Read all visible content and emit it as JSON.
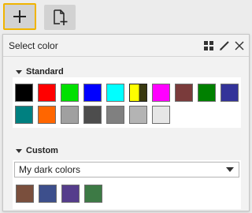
{
  "toolbar": {
    "add_icon": "plus-icon",
    "new_icon": "page-add-icon",
    "accent": "#f0b400"
  },
  "panel": {
    "title": "Select color",
    "icons": [
      "grid-icon",
      "pencil-icon",
      "close-icon"
    ]
  },
  "standard": {
    "label": "Standard",
    "colors": [
      "#000000",
      "#ff0000",
      "#00e000",
      "#0000ff",
      "#00ffff",
      "#ffff00",
      "#ff00ff",
      "#7a3b3b",
      "#008000",
      "#333399",
      "#008080",
      "#ff6600",
      "#a0a0a0",
      "#4d4d4d",
      "#808080",
      "#b4b4b4",
      "#e6e6e6"
    ],
    "selected_index": 5
  },
  "custom": {
    "label": "Custom",
    "dropdown_value": "My dark colors",
    "colors": [
      "#7a4f3d",
      "#3d4f8c",
      "#553d8c",
      "#3d7a45"
    ]
  }
}
